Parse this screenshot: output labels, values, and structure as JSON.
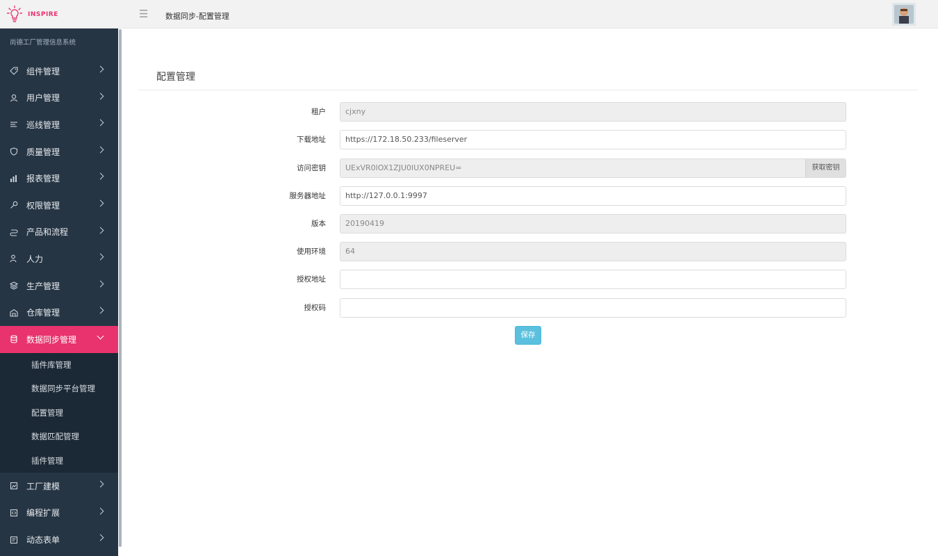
{
  "app": {
    "logo_text": "INSPIRE",
    "breadcrumb": "数据同步-配置管理",
    "brand_color": "#e8336e"
  },
  "sidebar": {
    "system_name": "尚德工厂管理信息系统",
    "items": [
      {
        "label": "组件管理",
        "icon": "tag-icon"
      },
      {
        "label": "用户管理",
        "icon": "users-icon"
      },
      {
        "label": "巡线管理",
        "icon": "list-icon"
      },
      {
        "label": "质量管理",
        "icon": "shield-icon"
      },
      {
        "label": "报表管理",
        "icon": "bar-chart-icon"
      },
      {
        "label": "权限管理",
        "icon": "key-icon"
      },
      {
        "label": "产品和流程",
        "icon": "flow-icon"
      },
      {
        "label": "人力",
        "icon": "person-icon"
      },
      {
        "label": "生产管理",
        "icon": "layers-icon"
      },
      {
        "label": "仓库管理",
        "icon": "warehouse-icon"
      },
      {
        "label": "数据同步管理",
        "icon": "database-icon",
        "active": true
      },
      {
        "label": "工厂建模",
        "icon": "factory-icon"
      },
      {
        "label": "编程扩展",
        "icon": "code-icon"
      },
      {
        "label": "动态表单",
        "icon": "form-icon"
      }
    ],
    "submenu": [
      {
        "label": "插件库管理"
      },
      {
        "label": "数据同步平台管理"
      },
      {
        "label": "配置管理"
      },
      {
        "label": "数据匹配管理"
      },
      {
        "label": "插件管理"
      }
    ]
  },
  "main": {
    "title": "配置管理",
    "fields": {
      "tenant": {
        "label": "租户",
        "value": "cjxny"
      },
      "download_url": {
        "label": "下载地址",
        "value": "https://172.18.50.233/fileserver"
      },
      "access_key": {
        "label": "访问密钥",
        "value": "UExVR0lOX1ZJU0lUX0NPREU=",
        "button": "获取密钥"
      },
      "server_url": {
        "label": "服务器地址",
        "value": "http://127.0.0.1:9997"
      },
      "version": {
        "label": "版本",
        "value": "20190419"
      },
      "environment": {
        "label": "使用环境",
        "value": "64"
      },
      "auth_url": {
        "label": "授权地址",
        "value": ""
      },
      "auth_code": {
        "label": "授权码",
        "value": ""
      }
    },
    "save_label": "保存"
  }
}
